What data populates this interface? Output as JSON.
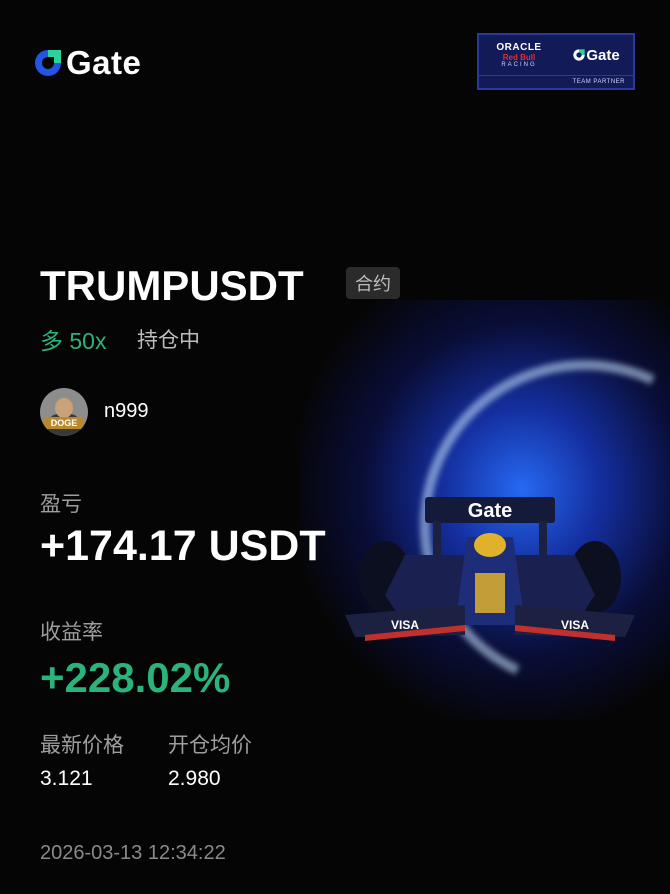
{
  "brand": {
    "name": "Gate",
    "accent": "#2354e6"
  },
  "partner_badge": {
    "oracle": "ORACLE",
    "redbull": "Red Bull",
    "racing": "RACING",
    "gate": "Gate",
    "caption": "TEAM PARTNER"
  },
  "position": {
    "pair": "TRUMPUSDT",
    "contract_tag": "合约",
    "direction": "多 50x",
    "status": "持仓中"
  },
  "user": {
    "name": "n999",
    "avatar_text": "DOGE"
  },
  "pnl": {
    "label": "盈亏",
    "value": "+174.17 USDT"
  },
  "roi": {
    "label": "收益率",
    "value": "+228.02%"
  },
  "prices": {
    "latest_label": "最新价格",
    "latest_value": "3.121",
    "entry_label": "开仓均价",
    "entry_value": "2.980"
  },
  "timestamp": "2026-03-13 12:34:22",
  "car_livery": {
    "gate_text": "Gate",
    "sponsor_left": "VISA",
    "sponsor_right": "VISA"
  },
  "colors": {
    "profit": "#2bb37c",
    "background": "#050505",
    "muted": "#9e9e9e"
  }
}
